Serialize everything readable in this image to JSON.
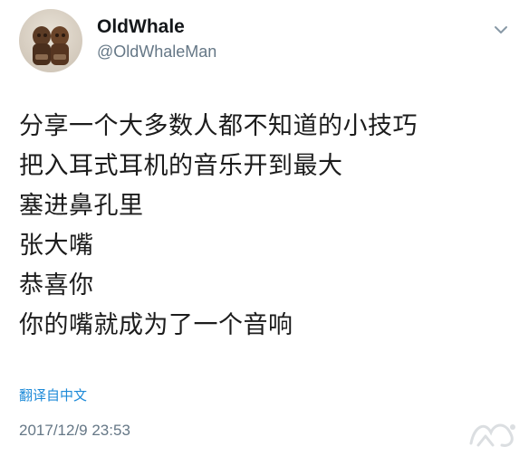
{
  "tweet": {
    "author": {
      "display_name": "OldWhale",
      "handle": "@OldWhaleMan"
    },
    "lines": [
      "分享一个大多数人都不知道的小技巧",
      "把入耳式耳机的音乐开到最大",
      "塞进鼻孔里",
      "张大嘴",
      "恭喜你",
      "你的嘴就成为了一个音响"
    ],
    "translate_label": "翻译自中文",
    "timestamp": "2017/12/9 23:53"
  },
  "icons": {
    "menu": "chevron-down-icon",
    "watermark": "site-watermark-logo"
  },
  "colors": {
    "link": "#1d8ad8",
    "secondary_text": "#657786",
    "primary_text": "#1c1c1c"
  }
}
